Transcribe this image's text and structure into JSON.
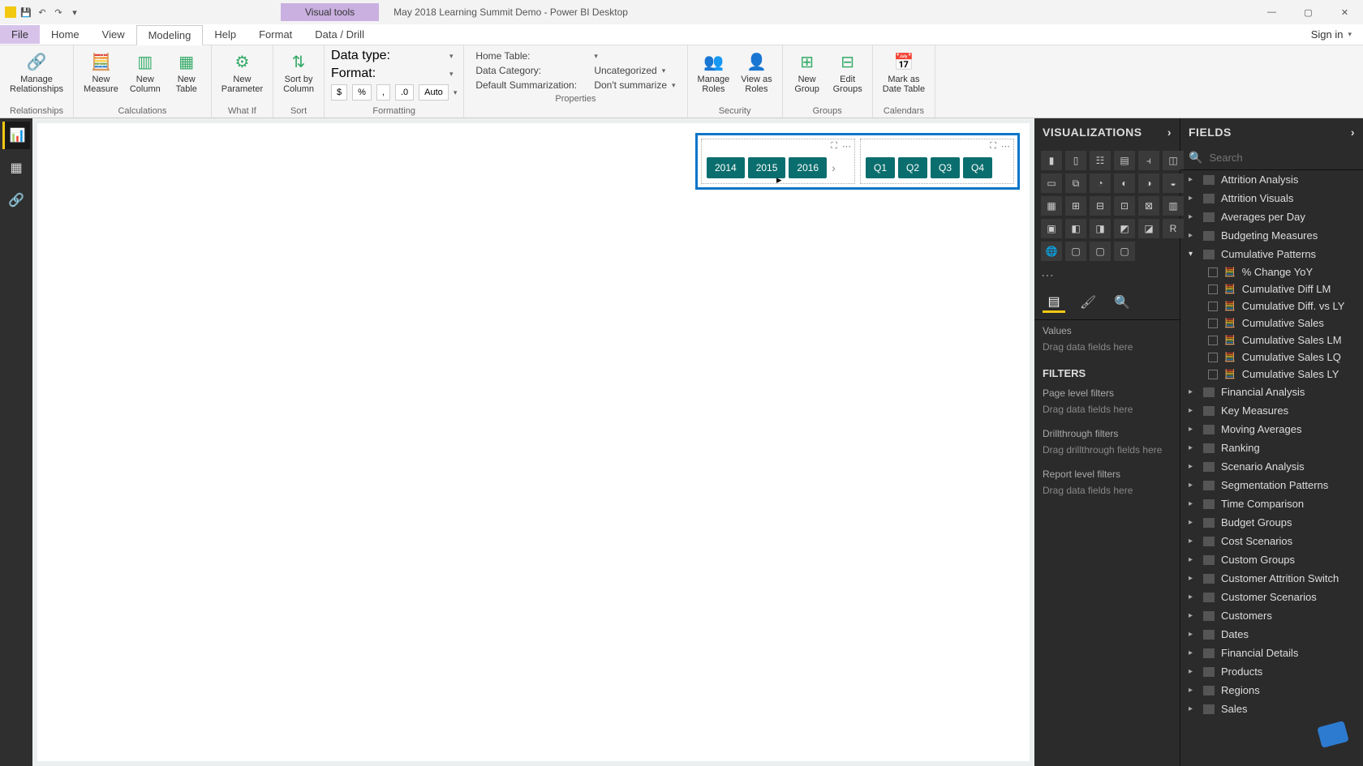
{
  "titlebar": {
    "app_title": "May 2018 Learning Summit Demo - Power BI Desktop",
    "visual_tools_label": "Visual tools",
    "signin": "Sign in"
  },
  "qat": {
    "save": "💾",
    "undo": "↶",
    "redo": "↷"
  },
  "win": {
    "min": "—",
    "max": "▢",
    "close": "✕"
  },
  "tabs": {
    "file": "File",
    "home": "Home",
    "view": "View",
    "modeling": "Modeling",
    "help": "Help",
    "format": "Format",
    "datadrill": "Data / Drill"
  },
  "ribbon": {
    "relationships": {
      "label": "Relationships",
      "manage": "Manage\nRelationships"
    },
    "calculations": {
      "label": "Calculations",
      "new_measure": "New\nMeasure",
      "new_column": "New\nColumn",
      "new_table": "New\nTable"
    },
    "whatif": {
      "label": "What If",
      "new_param": "New\nParameter"
    },
    "sort": {
      "label": "Sort",
      "sortby": "Sort by\nColumn"
    },
    "formatting": {
      "label": "Formatting",
      "data_type_k": "Data type:",
      "data_type_v": "",
      "format_k": "Format:",
      "currency": "$",
      "percent": "%",
      "comma": ",",
      "deczero": ".0",
      "auto": "Auto"
    },
    "properties": {
      "label": "Properties",
      "home_table_k": "Home Table:",
      "data_cat_k": "Data Category:",
      "data_cat_v": "Uncategorized",
      "def_sum_k": "Default Summarization:",
      "def_sum_v": "Don't summarize"
    },
    "security": {
      "label": "Security",
      "manage_roles": "Manage\nRoles",
      "view_as": "View as\nRoles"
    },
    "groups": {
      "label": "Groups",
      "new_group": "New\nGroup",
      "edit_groups": "Edit\nGroups"
    },
    "calendars": {
      "label": "Calendars",
      "mark_date": "Mark as\nDate Table"
    }
  },
  "slicers": {
    "years": [
      "2014",
      "2015",
      "2016"
    ],
    "quarters": [
      "Q1",
      "Q2",
      "Q3",
      "Q4"
    ]
  },
  "viz_pane": {
    "header": "VISUALIZATIONS",
    "values_label": "Values",
    "values_drop": "Drag data fields here",
    "filters_header": "FILTERS",
    "page_filters": "Page level filters",
    "page_drop": "Drag data fields here",
    "drill_filters": "Drillthrough filters",
    "drill_drop": "Drag drillthrough fields here",
    "report_filters": "Report level filters",
    "report_drop": "Drag data fields here"
  },
  "fields_pane": {
    "header": "FIELDS",
    "search_placeholder": "Search",
    "tables_top": [
      "Attrition Analysis",
      "Attrition Visuals",
      "Averages per Day",
      "Budgeting Measures"
    ],
    "expanded_table": "Cumulative Patterns",
    "expanded_fields": [
      "% Change YoY",
      "Cumulative Diff LM",
      "Cumulative Diff. vs LY",
      "Cumulative Sales",
      "Cumulative Sales LM",
      "Cumulative Sales LQ",
      "Cumulative Sales LY"
    ],
    "tables_rest": [
      "Financial Analysis",
      "Key Measures",
      "Moving Averages",
      "Ranking",
      "Scenario Analysis",
      "Segmentation Patterns",
      "Time Comparison",
      "Budget Groups",
      "Cost Scenarios",
      "Custom Groups",
      "Customer Attrition Switch",
      "Customer Scenarios",
      "Customers",
      "Dates",
      "Financial Details",
      "Products",
      "Regions",
      "Sales"
    ]
  }
}
